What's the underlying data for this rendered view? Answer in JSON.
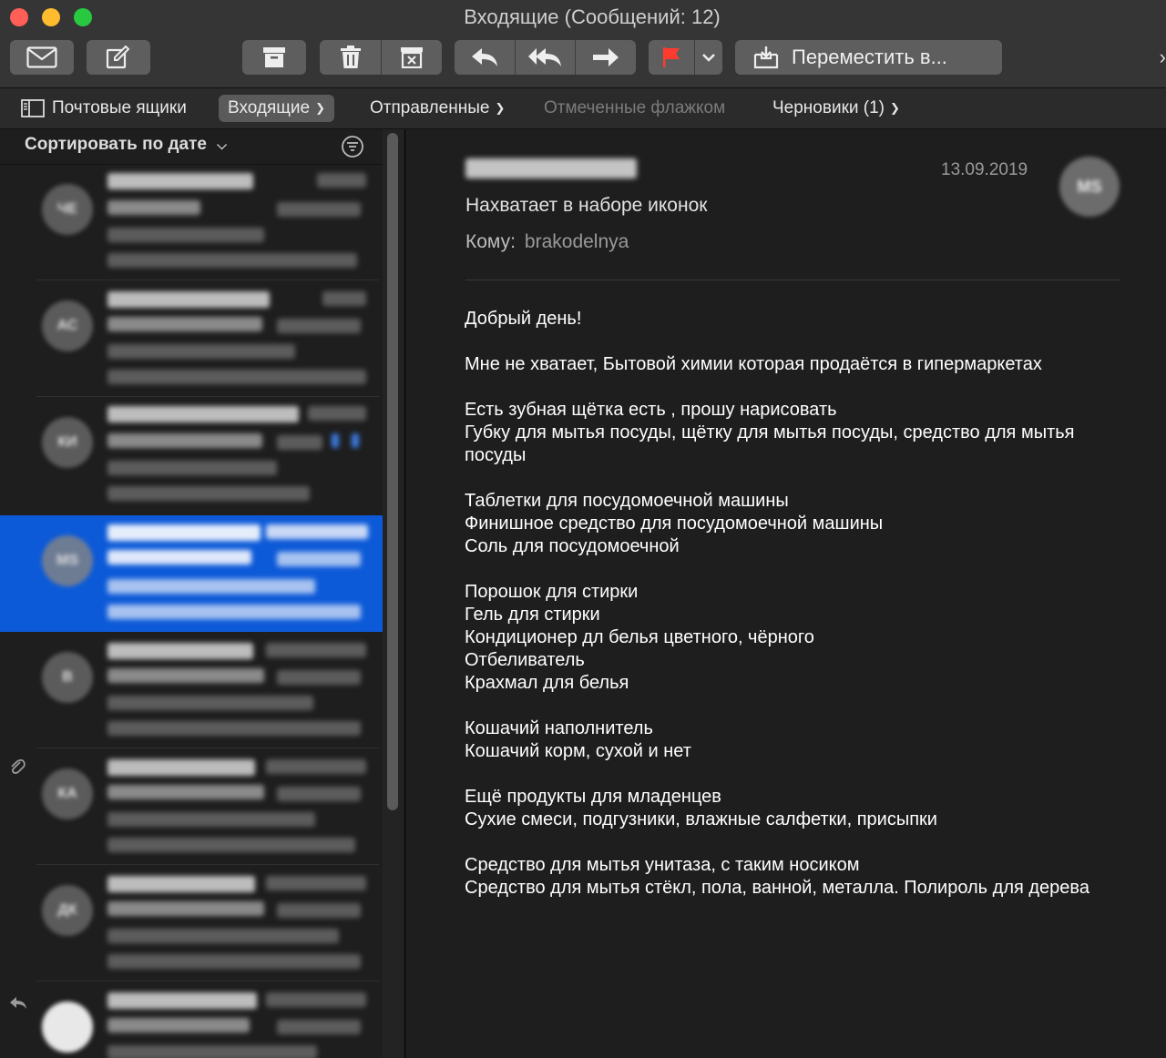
{
  "window": {
    "title": "Входящие (Сообщений: 12)"
  },
  "toolbar": {
    "move_label": "Переместить в...",
    "right_edge_glyph": "›"
  },
  "favorites": {
    "mailboxes": "Почтовые ящики",
    "inbox": "Входящие",
    "sent": "Отправленные",
    "flagged": "Отмеченные флажком",
    "drafts": "Черновики (1)"
  },
  "list": {
    "sort_label": "Сортировать по дате",
    "rows": [
      {
        "initials": "ЧЕ"
      },
      {
        "initials": "АС"
      },
      {
        "initials": "КИ"
      },
      {
        "initials": "MS",
        "selected": true
      },
      {
        "initials": "В"
      },
      {
        "initials": "КА",
        "attachment": true
      },
      {
        "initials": "ДК"
      },
      {
        "initials": "",
        "replied": true
      }
    ]
  },
  "message": {
    "date": "13.09.2019",
    "avatar_initials": "MS",
    "subject": "Нахватает в наборе иконок",
    "to_label": "Кому:",
    "to_value": "brakodelnya",
    "body": [
      [
        "Добрый день!"
      ],
      [
        "Мне не хватает, Бытовой химии которая продаётся в гипермаркетах"
      ],
      [
        "Есть зубная щётка есть , прошу нарисовать",
        "Губку для мытья посуды, щётку для мытья посуды, средство для мытья посуды"
      ],
      [
        "Таблетки для посудомоечной машины",
        "Финишное средство для посудомоечной машины",
        "Соль для посудомоечной"
      ],
      [
        "Порошок для стирки",
        "Гель для стирки",
        "Кондиционер дл белья цветного, чёрного",
        "Отбеливатель",
        "Крахмал для белья"
      ],
      [
        "Кошачий наполнитель",
        "Кошачий корм, сухой и нет"
      ],
      [
        "Ещё продукты для младенцев",
        "Сухие смеси, подгузники, влажные салфетки, присыпки"
      ],
      [
        "Средство для мытья унитаза, с таким носиком",
        "Средство для мытья стёкл, пола, ванной, металла. Полироль для дерева"
      ]
    ]
  },
  "colors": {
    "selection": "#0d5ad8",
    "flag": "#ff3b30",
    "toolbar": "#353535",
    "button": "#5e5e5e"
  }
}
